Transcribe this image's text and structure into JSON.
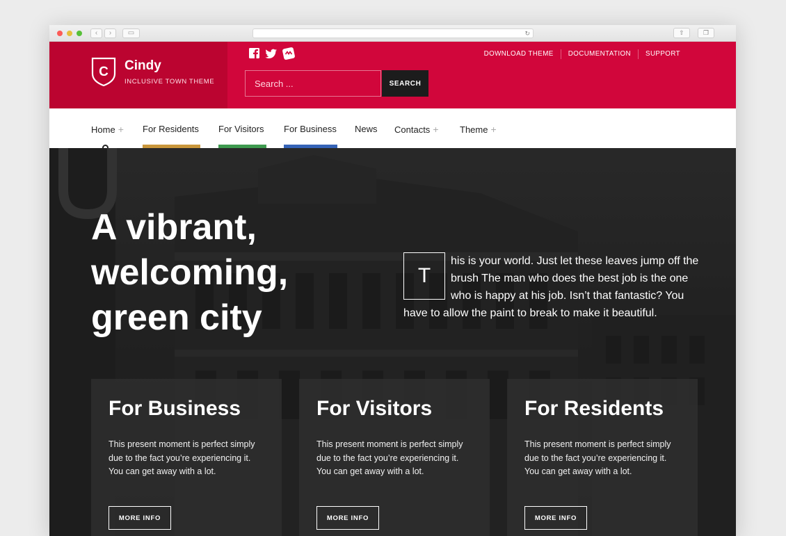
{
  "header": {
    "site_title": "Cindy",
    "tagline": "INCLUSIVE TOWN THEME",
    "logo_letter": "C",
    "social_icons": [
      "facebook-icon",
      "twitter-icon",
      "sitebadge-icon"
    ],
    "search": {
      "placeholder": "Search ...",
      "button": "SEARCH"
    },
    "top_links": [
      "DOWNLOAD THEME",
      "DOCUMENTATION",
      "SUPPORT"
    ]
  },
  "nav": {
    "items": [
      {
        "label": "Home",
        "has_submenu": true
      },
      {
        "label": "For Residents",
        "accent": "#c9963b"
      },
      {
        "label": "For Visitors",
        "accent": "#3e9a4f"
      },
      {
        "label": "For Business",
        "accent": "#3563b7"
      },
      {
        "label": "News"
      },
      {
        "label": "Contacts",
        "has_submenu": true
      },
      {
        "label": "Theme",
        "has_submenu": true
      }
    ],
    "submenu_glyph": "+"
  },
  "hero": {
    "title": "A vibrant, welcoming, green city",
    "dropcap": "T",
    "text": "his is your world. Just let these leaves jump off the brush The man who does the best job is the one who is happy at his job. Isn’t that fantastic? You have to allow the paint to break to make it beautiful."
  },
  "cards": [
    {
      "title": "For Business",
      "text": "This present moment is perfect simply due to the fact you’re experiencing it. You can get away with a lot.",
      "button": "MORE INFO"
    },
    {
      "title": "For Visitors",
      "text": "This present moment is perfect simply due to the fact you’re experiencing it. You can get away with a lot.",
      "button": "MORE INFO"
    },
    {
      "title": "For Residents",
      "text": "This present moment is perfect simply due to the fact you’re experiencing it. You can get away with a lot.",
      "button": "MORE INFO"
    }
  ],
  "colors": {
    "brand_red": "#d1063b",
    "brand_red_dark": "#bb0430",
    "search_button": "#1c1c1c"
  }
}
